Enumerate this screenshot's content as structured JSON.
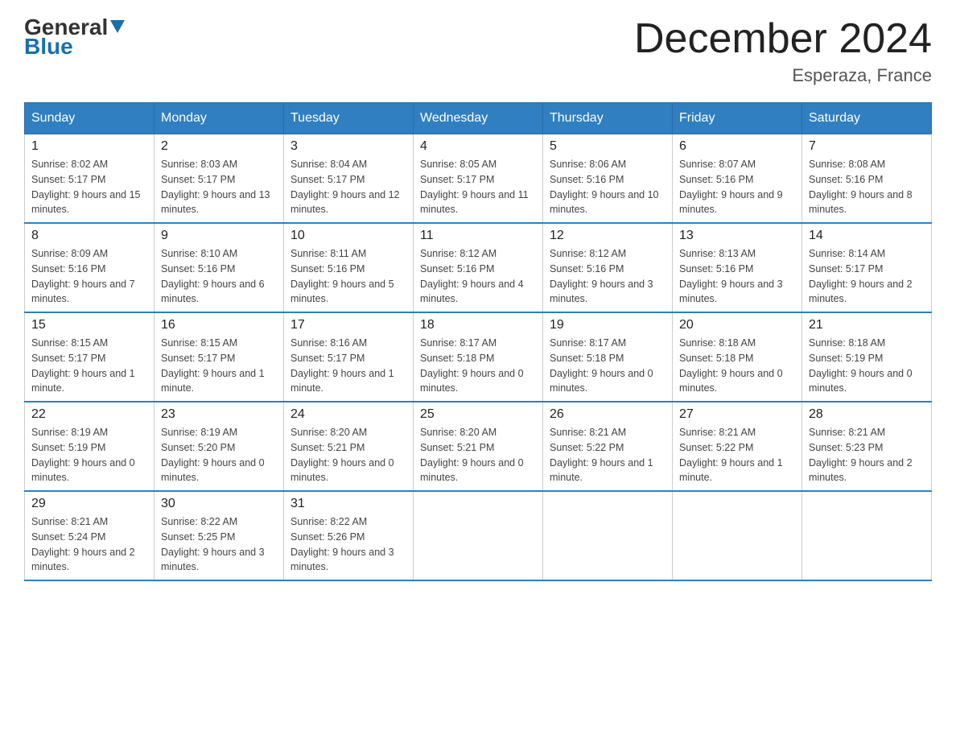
{
  "header": {
    "logo": {
      "line1": "General",
      "line2": "Blue",
      "arrow_color": "#1a6faf"
    },
    "title": "December 2024",
    "subtitle": "Esperaza, France"
  },
  "calendar": {
    "days_of_week": [
      "Sunday",
      "Monday",
      "Tuesday",
      "Wednesday",
      "Thursday",
      "Friday",
      "Saturday"
    ],
    "weeks": [
      [
        {
          "day": "1",
          "sunrise": "8:02 AM",
          "sunset": "5:17 PM",
          "daylight": "9 hours and 15 minutes."
        },
        {
          "day": "2",
          "sunrise": "8:03 AM",
          "sunset": "5:17 PM",
          "daylight": "9 hours and 13 minutes."
        },
        {
          "day": "3",
          "sunrise": "8:04 AM",
          "sunset": "5:17 PM",
          "daylight": "9 hours and 12 minutes."
        },
        {
          "day": "4",
          "sunrise": "8:05 AM",
          "sunset": "5:17 PM",
          "daylight": "9 hours and 11 minutes."
        },
        {
          "day": "5",
          "sunrise": "8:06 AM",
          "sunset": "5:16 PM",
          "daylight": "9 hours and 10 minutes."
        },
        {
          "day": "6",
          "sunrise": "8:07 AM",
          "sunset": "5:16 PM",
          "daylight": "9 hours and 9 minutes."
        },
        {
          "day": "7",
          "sunrise": "8:08 AM",
          "sunset": "5:16 PM",
          "daylight": "9 hours and 8 minutes."
        }
      ],
      [
        {
          "day": "8",
          "sunrise": "8:09 AM",
          "sunset": "5:16 PM",
          "daylight": "9 hours and 7 minutes."
        },
        {
          "day": "9",
          "sunrise": "8:10 AM",
          "sunset": "5:16 PM",
          "daylight": "9 hours and 6 minutes."
        },
        {
          "day": "10",
          "sunrise": "8:11 AM",
          "sunset": "5:16 PM",
          "daylight": "9 hours and 5 minutes."
        },
        {
          "day": "11",
          "sunrise": "8:12 AM",
          "sunset": "5:16 PM",
          "daylight": "9 hours and 4 minutes."
        },
        {
          "day": "12",
          "sunrise": "8:12 AM",
          "sunset": "5:16 PM",
          "daylight": "9 hours and 3 minutes."
        },
        {
          "day": "13",
          "sunrise": "8:13 AM",
          "sunset": "5:16 PM",
          "daylight": "9 hours and 3 minutes."
        },
        {
          "day": "14",
          "sunrise": "8:14 AM",
          "sunset": "5:17 PM",
          "daylight": "9 hours and 2 minutes."
        }
      ],
      [
        {
          "day": "15",
          "sunrise": "8:15 AM",
          "sunset": "5:17 PM",
          "daylight": "9 hours and 1 minute."
        },
        {
          "day": "16",
          "sunrise": "8:15 AM",
          "sunset": "5:17 PM",
          "daylight": "9 hours and 1 minute."
        },
        {
          "day": "17",
          "sunrise": "8:16 AM",
          "sunset": "5:17 PM",
          "daylight": "9 hours and 1 minute."
        },
        {
          "day": "18",
          "sunrise": "8:17 AM",
          "sunset": "5:18 PM",
          "daylight": "9 hours and 0 minutes."
        },
        {
          "day": "19",
          "sunrise": "8:17 AM",
          "sunset": "5:18 PM",
          "daylight": "9 hours and 0 minutes."
        },
        {
          "day": "20",
          "sunrise": "8:18 AM",
          "sunset": "5:18 PM",
          "daylight": "9 hours and 0 minutes."
        },
        {
          "day": "21",
          "sunrise": "8:18 AM",
          "sunset": "5:19 PM",
          "daylight": "9 hours and 0 minutes."
        }
      ],
      [
        {
          "day": "22",
          "sunrise": "8:19 AM",
          "sunset": "5:19 PM",
          "daylight": "9 hours and 0 minutes."
        },
        {
          "day": "23",
          "sunrise": "8:19 AM",
          "sunset": "5:20 PM",
          "daylight": "9 hours and 0 minutes."
        },
        {
          "day": "24",
          "sunrise": "8:20 AM",
          "sunset": "5:21 PM",
          "daylight": "9 hours and 0 minutes."
        },
        {
          "day": "25",
          "sunrise": "8:20 AM",
          "sunset": "5:21 PM",
          "daylight": "9 hours and 0 minutes."
        },
        {
          "day": "26",
          "sunrise": "8:21 AM",
          "sunset": "5:22 PM",
          "daylight": "9 hours and 1 minute."
        },
        {
          "day": "27",
          "sunrise": "8:21 AM",
          "sunset": "5:22 PM",
          "daylight": "9 hours and 1 minute."
        },
        {
          "day": "28",
          "sunrise": "8:21 AM",
          "sunset": "5:23 PM",
          "daylight": "9 hours and 2 minutes."
        }
      ],
      [
        {
          "day": "29",
          "sunrise": "8:21 AM",
          "sunset": "5:24 PM",
          "daylight": "9 hours and 2 minutes."
        },
        {
          "day": "30",
          "sunrise": "8:22 AM",
          "sunset": "5:25 PM",
          "daylight": "9 hours and 3 minutes."
        },
        {
          "day": "31",
          "sunrise": "8:22 AM",
          "sunset": "5:26 PM",
          "daylight": "9 hours and 3 minutes."
        },
        null,
        null,
        null,
        null
      ]
    ]
  }
}
